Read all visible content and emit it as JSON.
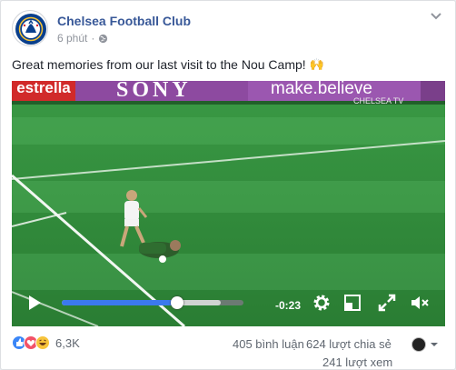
{
  "post": {
    "page_name": "Chelsea Football Club",
    "time": "6 phút",
    "caption": "Great memories from our last visit to the Nou Camp!",
    "caption_emoji": "🙌"
  },
  "video": {
    "banner_texts": [
      "estrella",
      "SONY",
      "make.believe",
      "CHELSEA TV"
    ],
    "time_remaining": "-0:23",
    "progress": 0.62,
    "buffered": 0.87
  },
  "stats": {
    "reaction_count": "6,3K",
    "comments": "405 bình luận",
    "shares": "624 lượt chia sẻ",
    "views": "241 lượt xem"
  },
  "colors": {
    "link": "#385898",
    "like": "#3b86f7",
    "love": "#f25268",
    "haha": "#f7c43b",
    "pitch": "#2f8a3a"
  },
  "icons": [
    "globe-icon",
    "chevron-down-icon",
    "play-icon",
    "settings-icon",
    "pip-icon",
    "fullscreen-icon",
    "mute-icon"
  ]
}
